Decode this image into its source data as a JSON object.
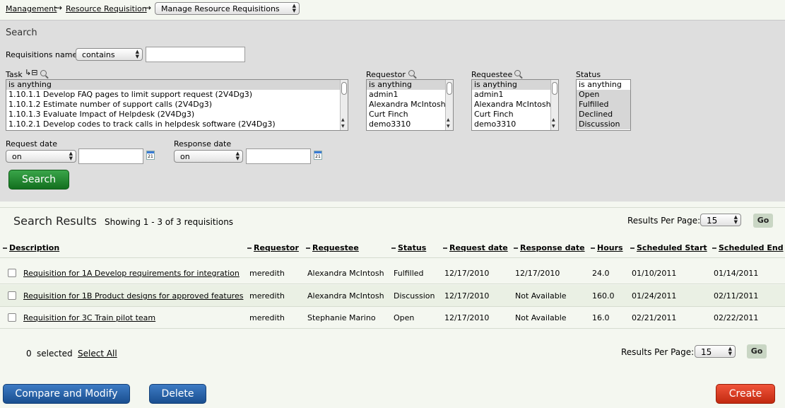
{
  "breadcrumb": {
    "items": [
      "Management",
      "Resource Requisition"
    ],
    "separator": "→",
    "current_select": "Manage Resource Requisitions"
  },
  "search": {
    "title": "Search",
    "req_name_label": "Requisitions name",
    "req_name_op": "contains",
    "req_name_value": "",
    "task": {
      "label": "Task",
      "options": [
        "is anything",
        "1.10.1.1 Develop FAQ pages to limit support request (2V4Dg3)",
        "1.10.1.2 Estimate number of support calls (2V4Dg3)",
        "1.10.1.3 Evaluate Impact of Helpdesk (2V4Dg3)",
        "1.10.2.1 Develop codes to track calls in helpdesk software (2V4Dg3)"
      ]
    },
    "requestor": {
      "label": "Requestor",
      "options": [
        "is anything",
        "admin1",
        "Alexandra McIntosh",
        "Curt Finch",
        "demo3310"
      ]
    },
    "requestee": {
      "label": "Requestee",
      "options": [
        "is anything",
        "admin1",
        "Alexandra McIntosh",
        "Curt Finch",
        "demo3310"
      ]
    },
    "status": {
      "label": "Status",
      "options": [
        "is anything",
        "Open",
        "Fulfilled",
        "Declined",
        "Discussion"
      ]
    },
    "request_date": {
      "label": "Request date",
      "op": "on",
      "value": ""
    },
    "response_date": {
      "label": "Response date",
      "op": "on",
      "value": ""
    },
    "calendar_day": "21",
    "search_button": "Search"
  },
  "results": {
    "title": "Search Results",
    "showing": "Showing 1 - 3 of 3 requisitions",
    "rpp_label": "Results Per Page:",
    "rpp_value": "15",
    "go_label": "Go",
    "columns": [
      "Description",
      "Requestor",
      "Requestee",
      "Status",
      "Request date",
      "Response date",
      "Hours",
      "Scheduled Start",
      "Scheduled End"
    ],
    "rows": [
      [
        "Requisition for 1A Develop requirements for integration",
        "meredith",
        "Alexandra McIntosh",
        "Fulfilled",
        "12/17/2010",
        "12/17/2010",
        "24.0",
        "01/10/2011",
        "01/14/2011"
      ],
      [
        "Requisition for 1B Product designs for approved features",
        "meredith",
        "Alexandra McIntosh",
        "Discussion",
        "12/17/2010",
        "Not Available",
        "160.0",
        "01/24/2011",
        "02/11/2011"
      ],
      [
        "Requisition for 3C Train pilot team",
        "meredith",
        "Stephanie Marino",
        "Open",
        "12/17/2010",
        "Not Available",
        "16.0",
        "02/21/2011",
        "02/22/2011"
      ]
    ]
  },
  "footer": {
    "selected_count": "0",
    "selected_label": "selected",
    "select_all": "Select All",
    "rpp_label": "Results Per Page:",
    "rpp_value": "15",
    "go_label": "Go",
    "compare_button": "Compare and Modify",
    "delete_button": "Delete",
    "create_button": "Create"
  },
  "colors": {
    "search_green": "#13701f",
    "blue_button": "#1a4f90",
    "red_button": "#c22a10",
    "panel_gray": "#dedede",
    "page_bg": "#f4f7f0"
  }
}
